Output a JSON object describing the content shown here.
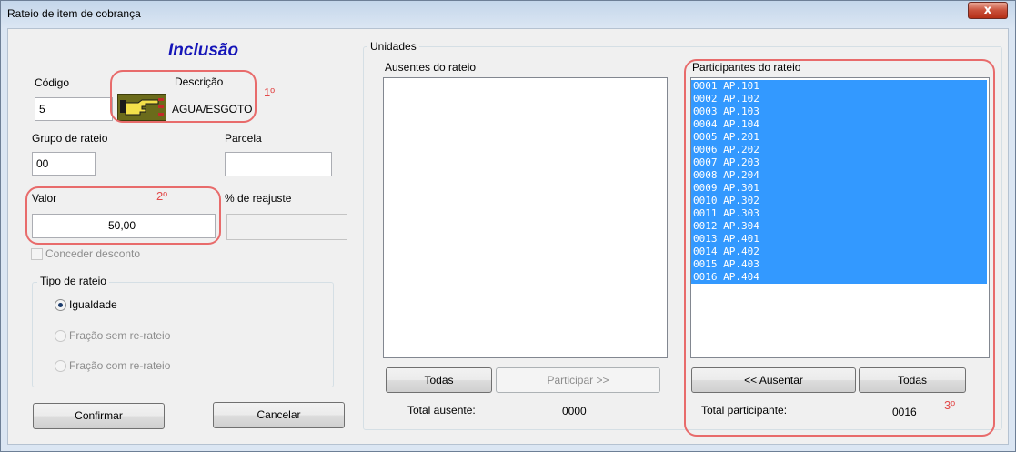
{
  "window": {
    "title": "Rateio de item de cobrança",
    "close_glyph": "x"
  },
  "form": {
    "heading": "Inclusão",
    "codigo_label": "Código",
    "codigo_value": "5",
    "descricao_label": "Descrição",
    "descricao_value": "AGUA/ESGOTO",
    "descricao_icon": "pointing-hand-icon",
    "grupo_label": "Grupo de rateio",
    "grupo_value": "00",
    "parcela_label": "Parcela",
    "parcela_value": "",
    "valor_label": "Valor",
    "valor_value": "50,00",
    "reajuste_label": "% de reajuste",
    "reajuste_value": "",
    "desconto_label": "Conceder desconto",
    "desconto_checked": false,
    "tipo_rateio": {
      "legend": "Tipo de rateio",
      "options": [
        {
          "label": "Igualdade",
          "checked": true,
          "enabled": true
        },
        {
          "label": "Fração sem re-rateio",
          "checked": false,
          "enabled": false
        },
        {
          "label": "Fração com re-rateio",
          "checked": false,
          "enabled": false
        }
      ]
    },
    "confirm_label": "Confirmar",
    "cancel_label": "Cancelar"
  },
  "unidades": {
    "legend": "Unidades",
    "ausentes_label": "Ausentes do rateio",
    "ausentes_items": [],
    "participantes_label": "Participantes do rateio",
    "participantes_items": [
      "0001 AP.101",
      "0002 AP.102",
      "0003 AP.103",
      "0004 AP.104",
      "0005 AP.201",
      "0006 AP.202",
      "0007 AP.203",
      "0008 AP.204",
      "0009 AP.301",
      "0010 AP.302",
      "0011 AP.303",
      "0012 AP.304",
      "0013 AP.401",
      "0014 AP.402",
      "0015 AP.403",
      "0016 AP.404"
    ],
    "todas_left_label": "Todas",
    "participar_label": "Participar >>",
    "ausentar_label": "<< Ausentar",
    "todas_right_label": "Todas",
    "total_ausente_label": "Total ausente:",
    "total_ausente_value": "0000",
    "total_participante_label": "Total participante:",
    "total_participante_value": "0016"
  },
  "annotations": {
    "a1": "1º",
    "a2": "2º",
    "a3": "3º"
  },
  "colors": {
    "heading": "#1515b8",
    "selection": "#3399ff",
    "annotation": "#e24a4a",
    "close_button": "#c9503a"
  }
}
